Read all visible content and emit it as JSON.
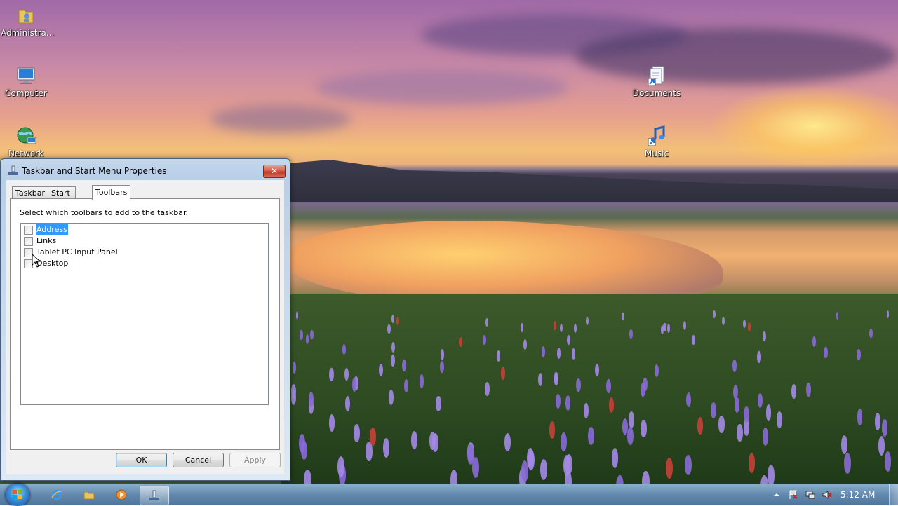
{
  "desktop": {
    "icons": [
      {
        "label": "Administra...",
        "icon": "user-folder-icon"
      },
      {
        "label": "Computer",
        "icon": "computer-icon"
      },
      {
        "label": "Network",
        "icon": "network-icon"
      },
      {
        "label": "Documents",
        "icon": "documents-shortcut-icon"
      },
      {
        "label": "Music",
        "icon": "music-shortcut-icon"
      }
    ]
  },
  "dialog": {
    "title": "Taskbar and Start Menu Properties",
    "close_label": "✕",
    "tabs": [
      {
        "label": "Taskbar",
        "active": false
      },
      {
        "label": "Start Menu",
        "active": false
      },
      {
        "label": "Toolbars",
        "active": true
      }
    ],
    "instruction": "Select which toolbars to add to the taskbar.",
    "toolbars": [
      {
        "label": "Address",
        "checked": false,
        "selected": true
      },
      {
        "label": "Links",
        "checked": false,
        "selected": false
      },
      {
        "label": "Tablet PC Input Panel",
        "checked": false,
        "selected": false
      },
      {
        "label": "Desktop",
        "checked": false,
        "selected": false
      }
    ],
    "buttons": {
      "ok": "OK",
      "cancel": "Cancel",
      "apply": "Apply"
    }
  },
  "taskbar": {
    "pinned": [
      "internet-explorer-icon",
      "windows-explorer-icon",
      "media-player-icon",
      "taskbar-properties-icon"
    ],
    "tray_icons": [
      "show-hidden-icons-arrow",
      "action-center-icon",
      "network-tray-icon",
      "volume-muted-icon"
    ],
    "clock": "5:12 AM"
  },
  "colors": {
    "selection": "#3399ff",
    "close_button": "#c03a28",
    "taskbar": "#5a82aa"
  }
}
